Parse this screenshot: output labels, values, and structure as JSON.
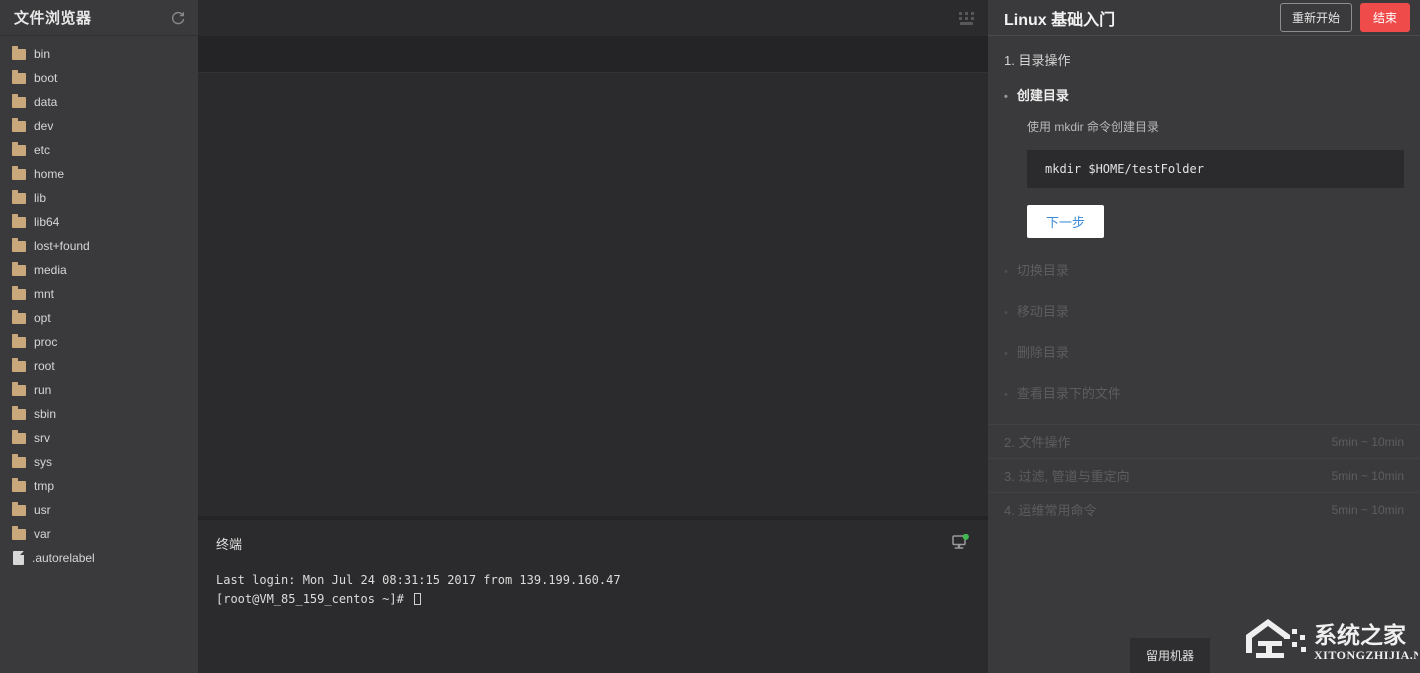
{
  "filebrowser": {
    "title": "文件浏览器",
    "refresh_icon": "refresh-icon",
    "keyboard_icon": "keyboard-icon",
    "items": [
      {
        "name": "bin",
        "type": "folder"
      },
      {
        "name": "boot",
        "type": "folder"
      },
      {
        "name": "data",
        "type": "folder"
      },
      {
        "name": "dev",
        "type": "folder"
      },
      {
        "name": "etc",
        "type": "folder"
      },
      {
        "name": "home",
        "type": "folder"
      },
      {
        "name": "lib",
        "type": "folder"
      },
      {
        "name": "lib64",
        "type": "folder"
      },
      {
        "name": "lost+found",
        "type": "folder"
      },
      {
        "name": "media",
        "type": "folder"
      },
      {
        "name": "mnt",
        "type": "folder"
      },
      {
        "name": "opt",
        "type": "folder"
      },
      {
        "name": "proc",
        "type": "folder"
      },
      {
        "name": "root",
        "type": "folder"
      },
      {
        "name": "run",
        "type": "folder"
      },
      {
        "name": "sbin",
        "type": "folder"
      },
      {
        "name": "srv",
        "type": "folder"
      },
      {
        "name": "sys",
        "type": "folder"
      },
      {
        "name": "tmp",
        "type": "folder"
      },
      {
        "name": "usr",
        "type": "folder"
      },
      {
        "name": "var",
        "type": "folder"
      },
      {
        "name": ".autorelabel",
        "type": "file"
      }
    ]
  },
  "terminal": {
    "title": "终端",
    "status_icon": "monitor-icon",
    "status_color": "#3fb950",
    "lines": [
      "Last login: Mon Jul 24 08:31:15 2017 from 139.199.160.47",
      "[root@VM_85_159_centos ~]# "
    ]
  },
  "lesson": {
    "title": "Linux 基础入门",
    "restart_label": "重新开始",
    "end_label": "结束",
    "end_color": "#ef4b4b",
    "current_section": "1. 目录操作",
    "active_step": {
      "title": "创建目录",
      "description": "使用 mkdir 命令创建目录",
      "code": "mkdir $HOME/testFolder",
      "next_label": "下一步"
    },
    "locked_steps": [
      "切换目录",
      "移动目录",
      "删除目录",
      "查看目录下的文件"
    ],
    "sections": [
      {
        "name": "2. 文件操作",
        "duration": "5min ~ 10min"
      },
      {
        "name": "3. 过滤, 管道与重定向",
        "duration": "5min ~ 10min"
      },
      {
        "name": "4. 运维常用命令",
        "duration": "5min ~ 10min"
      }
    ],
    "keep_machine_label": "留用机器"
  },
  "watermark": {
    "title": "系统之家",
    "subtitle": "XITONGZHIJIA.NET"
  }
}
